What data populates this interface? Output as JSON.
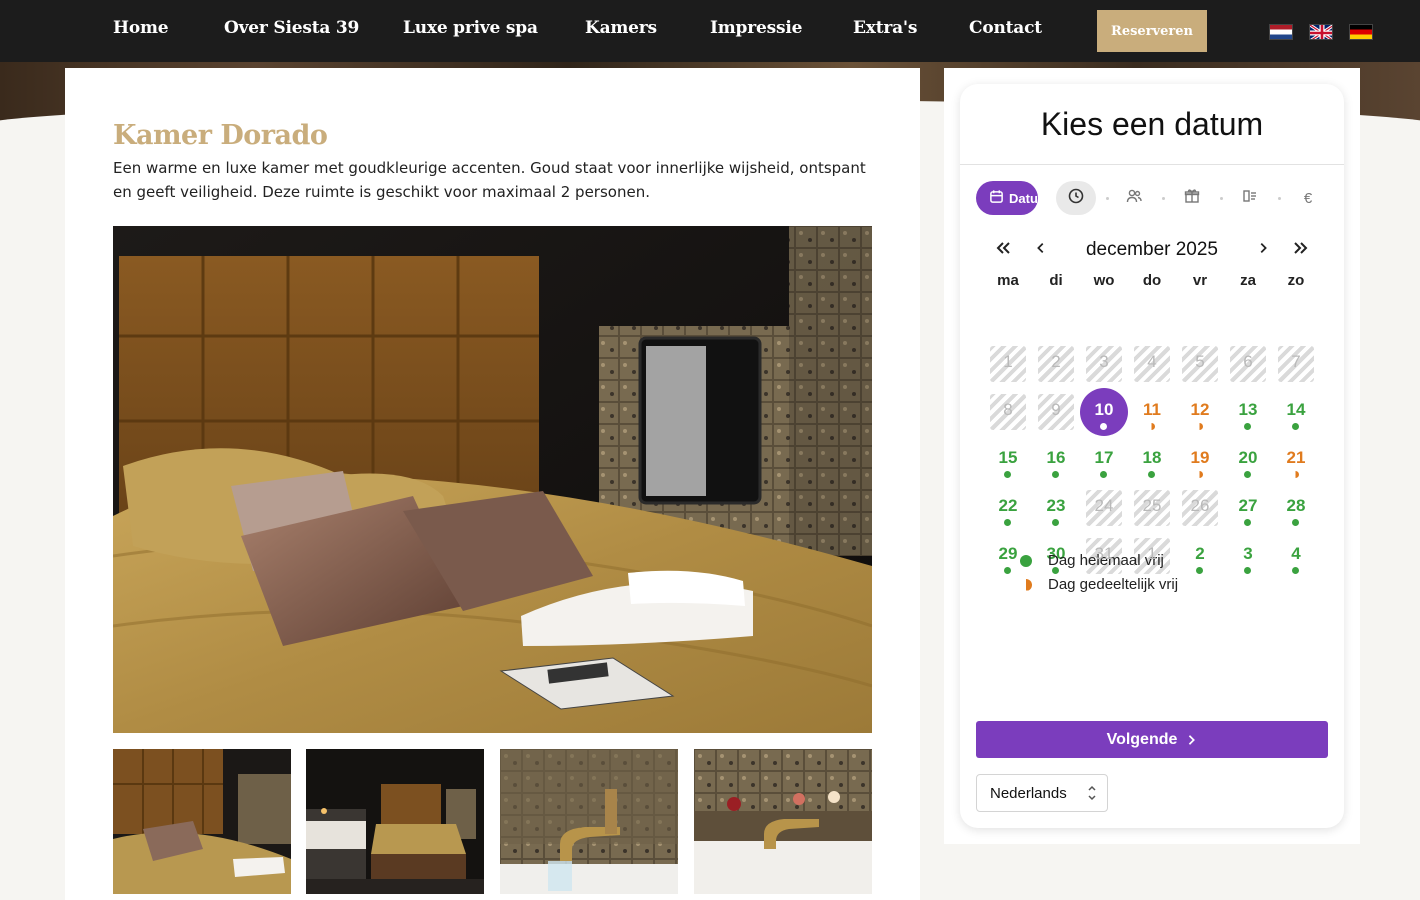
{
  "nav": {
    "items": [
      "Home",
      "Over Siesta 39",
      "Luxe prive spa",
      "Kamers",
      "Impressie",
      "Extra's",
      "Contact"
    ],
    "cta": "Reserveren",
    "flags": [
      "nl-flag",
      "uk-flag",
      "de-flag"
    ]
  },
  "room": {
    "title": "Kamer Dorado",
    "description": "Een warme en luxe kamer met goudkleurige accenten. Goud staat voor innerlijke wijsheid, ontspant en geeft veiligheid. Deze ruimte is geschikt voor maximaal 2 personen."
  },
  "booking": {
    "title": "Kies een datum",
    "active_step_label": "Datum",
    "steps": [
      "calendar-icon",
      "clock-icon",
      "users-icon",
      "gift-icon",
      "options-icon",
      "euro-icon"
    ],
    "euro_symbol": "€",
    "month": "december 2025",
    "weekdays": [
      "ma",
      "di",
      "wo",
      "do",
      "vr",
      "za",
      "zo"
    ],
    "days": [
      {
        "n": "1",
        "s": "unav"
      },
      {
        "n": "2",
        "s": "unav"
      },
      {
        "n": "3",
        "s": "unav"
      },
      {
        "n": "4",
        "s": "unav"
      },
      {
        "n": "5",
        "s": "unav"
      },
      {
        "n": "6",
        "s": "unav"
      },
      {
        "n": "7",
        "s": "unav"
      },
      {
        "n": "8",
        "s": "unav"
      },
      {
        "n": "9",
        "s": "unav"
      },
      {
        "n": "10",
        "s": "selected"
      },
      {
        "n": "11",
        "s": "partial"
      },
      {
        "n": "12",
        "s": "partial"
      },
      {
        "n": "13",
        "s": "free"
      },
      {
        "n": "14",
        "s": "free"
      },
      {
        "n": "15",
        "s": "free"
      },
      {
        "n": "16",
        "s": "free"
      },
      {
        "n": "17",
        "s": "free"
      },
      {
        "n": "18",
        "s": "free"
      },
      {
        "n": "19",
        "s": "partial"
      },
      {
        "n": "20",
        "s": "free"
      },
      {
        "n": "21",
        "s": "partial"
      },
      {
        "n": "22",
        "s": "free"
      },
      {
        "n": "23",
        "s": "free"
      },
      {
        "n": "24",
        "s": "unav"
      },
      {
        "n": "25",
        "s": "unav"
      },
      {
        "n": "26",
        "s": "unav"
      },
      {
        "n": "27",
        "s": "free"
      },
      {
        "n": "28",
        "s": "free"
      },
      {
        "n": "29",
        "s": "free"
      },
      {
        "n": "30",
        "s": "free"
      },
      {
        "n": "31",
        "s": "unav"
      },
      {
        "n": "1",
        "s": "unav"
      },
      {
        "n": "2",
        "s": "free"
      },
      {
        "n": "3",
        "s": "free"
      },
      {
        "n": "4",
        "s": "free"
      }
    ],
    "legend": {
      "free": "Dag helemaal vrij",
      "partial": "Dag gedeeltelijk vrij"
    },
    "next_label": "Volgende",
    "language": "Nederlands"
  },
  "colors": {
    "accent_purple": "#7b3dbd",
    "gold": "#c9ad7c",
    "free_green": "#3aa23f",
    "partial_orange": "#e07b1e",
    "nav_bg": "#1c1c1c"
  }
}
